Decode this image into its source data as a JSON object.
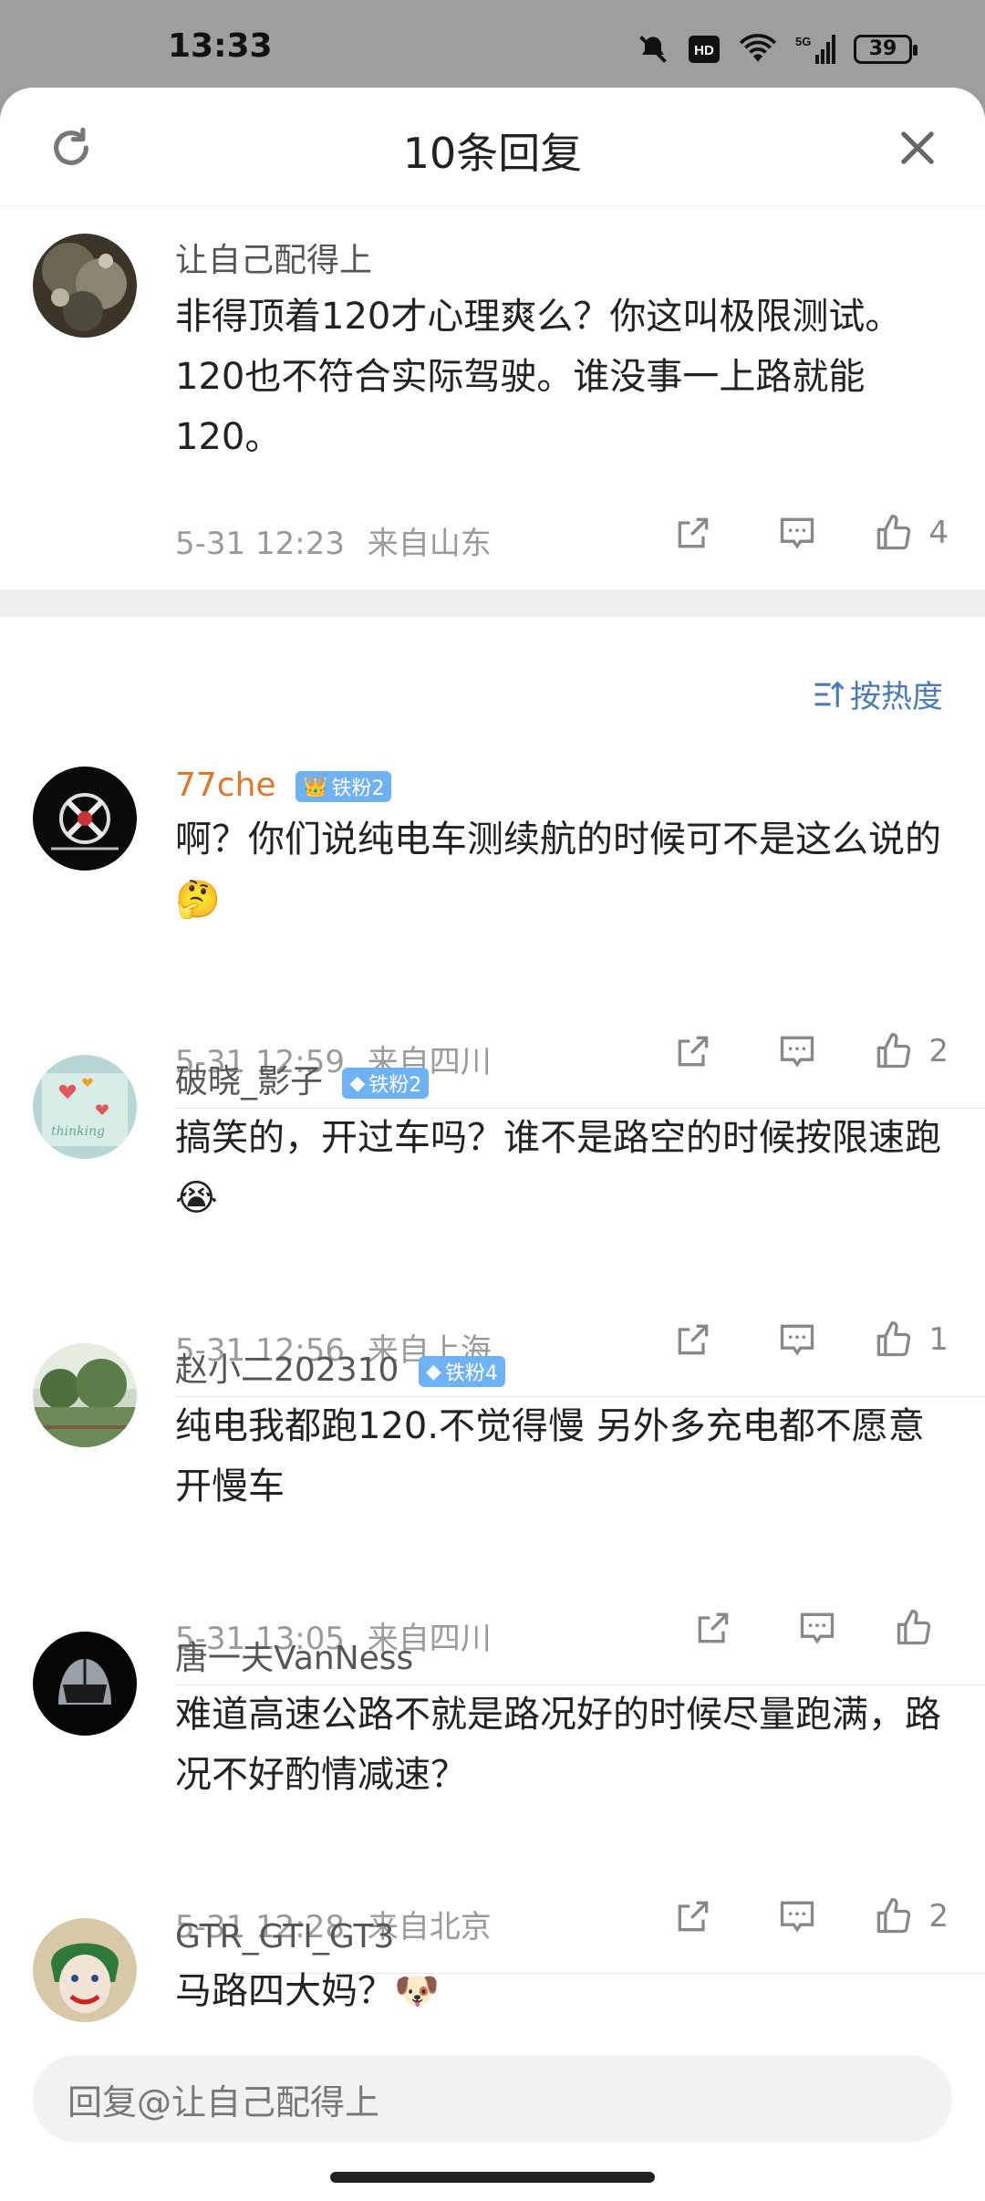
{
  "status": {
    "time": "13:33",
    "battery": "39",
    "network": "5G"
  },
  "header": {
    "title": "10条回复"
  },
  "original": {
    "name": "让自己配得上",
    "content": "非得顶着120才心理爽么？你这叫极限测试。 120也不符合实际驾驶。谁没事一上路就能120。",
    "time": "5-31 12:23",
    "location": "来自山东",
    "likes": "4"
  },
  "sort_label": "按热度",
  "comments": [
    {
      "name": "77che",
      "badge": "铁粉2",
      "content": "啊？你们说纯电车测续航的时候可不是这么说的🤔",
      "time": "5-31 12:59",
      "location": "来自四川",
      "likes": "2"
    },
    {
      "name": "破晓_影子",
      "badge": "铁粉2",
      "content": "搞笑的，开过车吗？谁不是路空的时候按限速跑😭",
      "time": "5-31 12:56",
      "location": "来自上海",
      "likes": "1"
    },
    {
      "name": "赵小二202310",
      "badge": "铁粉4",
      "content": "纯电我都跑120.不觉得慢  另外多充电都不愿意开慢车",
      "time": "5-31 13:05",
      "location": "来自四川",
      "likes": ""
    },
    {
      "name": "唐一夫VanNess",
      "badge": "",
      "content": "难道高速公路不就是路况好的时候尽量跑满，路况不好酌情减速？",
      "time": "5-31 12:28",
      "location": "来自北京",
      "likes": "2"
    },
    {
      "name": "GTR_GTI_GT3",
      "badge": "",
      "content": "马路四大妈？🐶",
      "time": "",
      "location": "",
      "likes": ""
    }
  ],
  "reply_placeholder": "回复@让自己配得上",
  "colors": {
    "name_orange": "#e0762b",
    "badge_blue": "#6fb1f5",
    "sort_blue": "#4a7bb7"
  }
}
